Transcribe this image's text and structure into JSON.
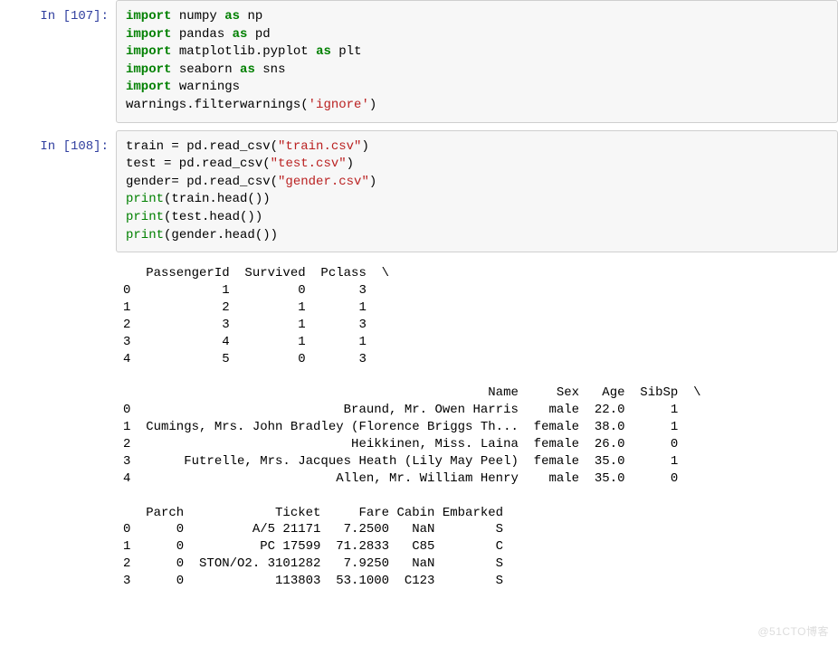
{
  "cells": [
    {
      "prompt_label": "In ",
      "prompt_num": "[107]:",
      "code": {
        "lines": [
          [
            {
              "t": "import",
              "c": "kw-green"
            },
            {
              "t": " numpy "
            },
            {
              "t": "as",
              "c": "kw-as"
            },
            {
              "t": " np"
            }
          ],
          [
            {
              "t": "import",
              "c": "kw-green"
            },
            {
              "t": " pandas "
            },
            {
              "t": "as",
              "c": "kw-as"
            },
            {
              "t": " pd"
            }
          ],
          [
            {
              "t": "import",
              "c": "kw-green"
            },
            {
              "t": " matplotlib.pyplot "
            },
            {
              "t": "as",
              "c": "kw-as"
            },
            {
              "t": " plt"
            }
          ],
          [
            {
              "t": "import",
              "c": "kw-green"
            },
            {
              "t": " seaborn "
            },
            {
              "t": "as",
              "c": "kw-as"
            },
            {
              "t": " sns"
            }
          ],
          [
            {
              "t": "import",
              "c": "kw-green"
            },
            {
              "t": " warnings"
            }
          ],
          [
            {
              "t": "warnings.filterwarnings("
            },
            {
              "t": "'ignore'",
              "c": "str-red"
            },
            {
              "t": ")"
            }
          ]
        ]
      }
    },
    {
      "prompt_label": "In ",
      "prompt_num": "[108]:",
      "code": {
        "lines": [
          [
            {
              "t": "train = pd.read_csv("
            },
            {
              "t": "\"train.csv\"",
              "c": "str-red"
            },
            {
              "t": ")"
            }
          ],
          [
            {
              "t": "test = pd.read_csv("
            },
            {
              "t": "\"test.csv\"",
              "c": "str-red"
            },
            {
              "t": ")"
            }
          ],
          [
            {
              "t": "gender= pd.read_csv("
            },
            {
              "t": "\"gender.csv\"",
              "c": "str-red"
            },
            {
              "t": ")"
            }
          ],
          [
            {
              "t": "print",
              "c": "builtin"
            },
            {
              "t": "(train.head())"
            }
          ],
          [
            {
              "t": "print",
              "c": "builtin"
            },
            {
              "t": "(test.head())"
            }
          ],
          [
            {
              "t": "print",
              "c": "builtin"
            },
            {
              "t": "(gender.head())"
            }
          ]
        ]
      },
      "output_text": "   PassengerId  Survived  Pclass  \\\n0            1         0       3   \n1            2         1       1   \n2            3         1       3   \n3            4         1       1   \n4            5         0       3   \n\n                                                Name     Sex   Age  SibSp  \\\n0                            Braund, Mr. Owen Harris    male  22.0      1   \n1  Cumings, Mrs. John Bradley (Florence Briggs Th...  female  38.0      1   \n2                             Heikkinen, Miss. Laina  female  26.0      0   \n3       Futrelle, Mrs. Jacques Heath (Lily May Peel)  female  35.0      1   \n4                           Allen, Mr. William Henry    male  35.0      0   \n\n   Parch            Ticket     Fare Cabin Embarked  \n0      0         A/5 21171   7.2500   NaN        S  \n1      0          PC 17599  71.2833   C85        C  \n2      0  STON/O2. 3101282   7.9250   NaN        S  \n3      0            113803  53.1000  C123        S  "
    }
  ],
  "watermark": "@51CTO博客"
}
